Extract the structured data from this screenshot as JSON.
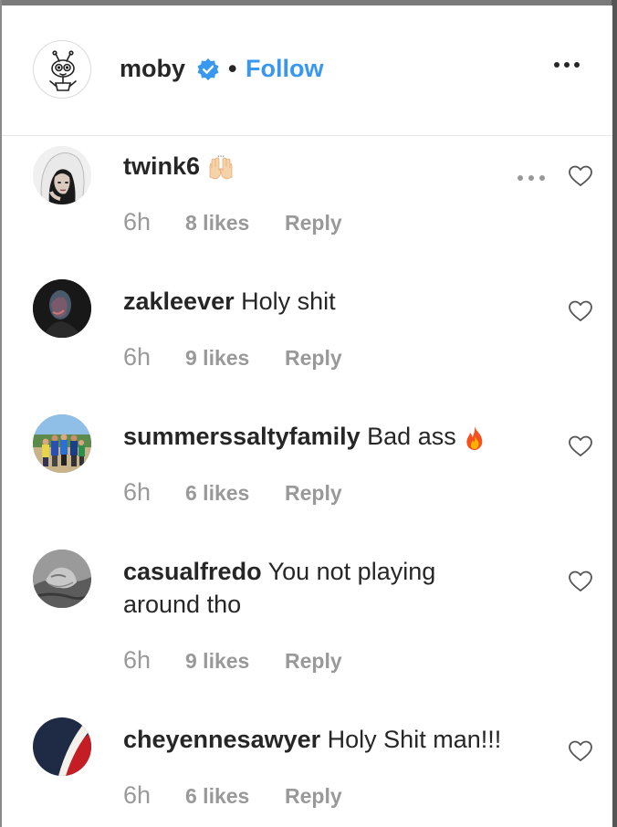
{
  "post": {
    "author": "moby",
    "separator": "•",
    "follow_label": "Follow"
  },
  "comments": [
    {
      "username": "twink6",
      "text": "",
      "emoji": "raising-hands",
      "time": "6h",
      "likes": "8 likes",
      "reply": "Reply"
    },
    {
      "username": "zakleever",
      "text": "Holy shit",
      "time": "6h",
      "likes": "9 likes",
      "reply": "Reply"
    },
    {
      "username": "summerssaltyfamily",
      "text": "Bad ass",
      "emoji": "fire",
      "time": "6h",
      "likes": "6 likes",
      "reply": "Reply"
    },
    {
      "username": "casualfredo",
      "text": "You not playing around tho",
      "time": "6h",
      "likes": "9 likes",
      "reply": "Reply"
    },
    {
      "username": "cheyennesawyer",
      "text": "Holy Shit man!!!",
      "time": "6h",
      "likes": "6 likes",
      "reply": "Reply"
    }
  ],
  "colors": {
    "follow": "#3897f0",
    "text": "#262626",
    "meta": "#999999",
    "verified": "#3897f0"
  }
}
